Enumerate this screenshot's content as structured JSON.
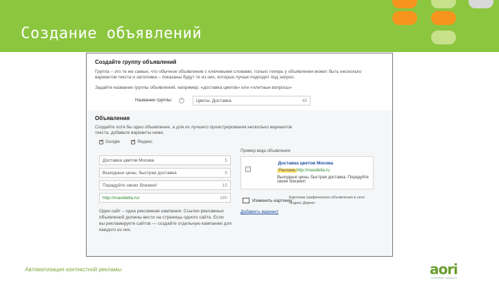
{
  "slide": {
    "title": "Создание объявлений",
    "footer": "Автоматизация контекстной рекламы",
    "logo": "aori",
    "logo_sub": "INTERNET AGENCY"
  },
  "decor": {
    "dots": [
      "#f7941d",
      "#c7e08a",
      "#d9d9d9",
      "#f7941d",
      "#f7941d",
      "#8cc63f",
      "#8cc63f",
      "#c7e08a"
    ]
  },
  "group": {
    "heading": "Создайте группу объявлений",
    "desc_line1": "Группа – это те же самые, что обычное объявление с ключевыми словами, только теперь у объявления может быть несколько",
    "desc_line2": "вариантов текста и заголовка – показаны будут те из них, которые лучше подходят под запрос.",
    "hint": "Задайте название группы объявлений, например: «доставка цветов» или «плитные вопросы»",
    "name_label": "Название группы:",
    "name_value": "Цветы. Доставка",
    "name_count": "45"
  },
  "ads": {
    "heading": "Объявления",
    "desc_line1": "Создайте хотя бы одно объявление, а для их лучшего проистрирования несколько вариантов",
    "desc_line2": "текста, добавьте варианты ниже.",
    "google_label": "Google",
    "yandex_label": "Яндекс",
    "fields": [
      {
        "value": "Доставка цветов Москва",
        "count": "5"
      },
      {
        "value": "Выходные цены, быстрая доставка",
        "count": "5"
      },
      {
        "value": "Порадуйте своих близких!",
        "count": "15"
      },
      {
        "value": "http://maxidelta.ru/",
        "count": "180"
      }
    ],
    "note_line1": "Один сайт – одна рекламная кампания. Ссылки рекламных",
    "note_line2": "объявлений должны вести на страницы одного сайта. Если",
    "note_line3": "вы рекламируете сайтов — создайте отдельную кампанию для",
    "note_line4": "каждого из них."
  },
  "preview": {
    "caption": "Пример вида объявления",
    "title": "Доставка цветов Москва",
    "badge": "Реклама",
    "url": "http://maxidelta.ru",
    "text": "Выходные цены, быстрая доставка. Порадуйте своих близких!",
    "image_button": "Изменить картинку",
    "image_note1": "Картинки графического объявления в сети",
    "image_note2": "Яндекс.Директ",
    "add_variant": "Добавить вариант"
  }
}
